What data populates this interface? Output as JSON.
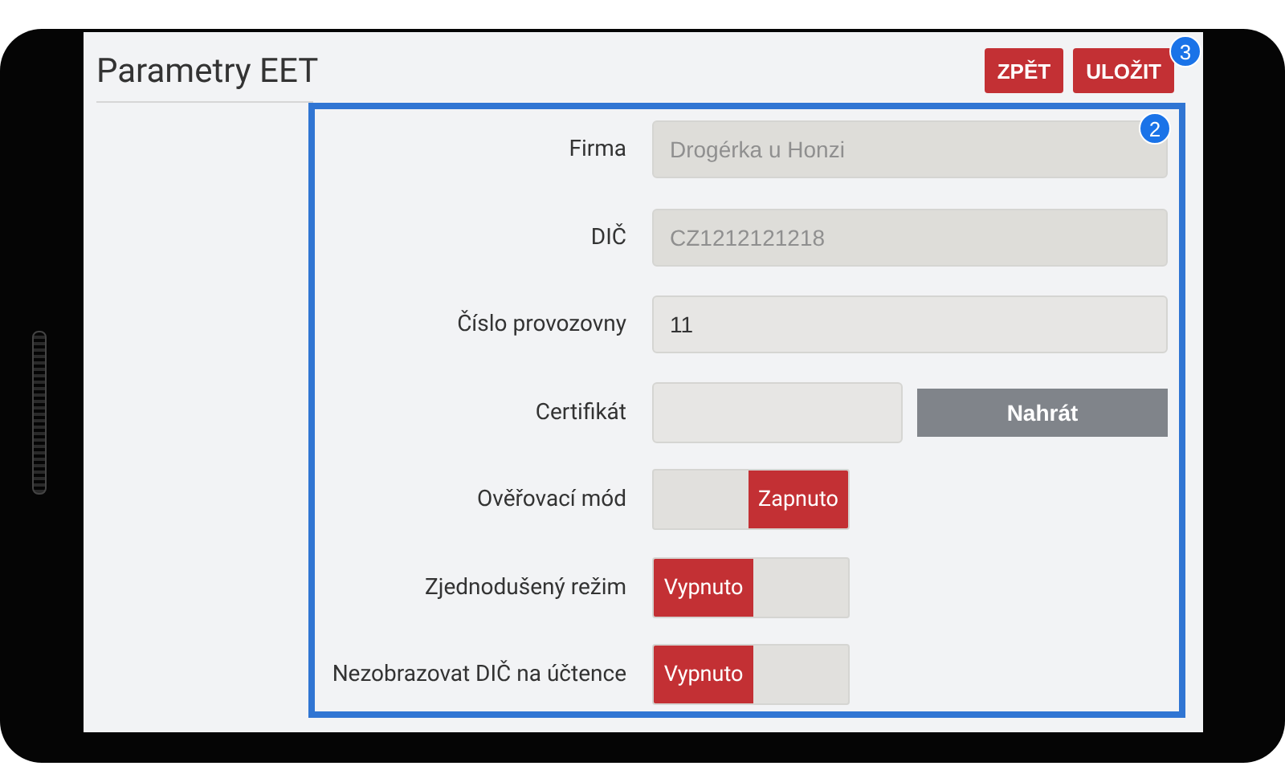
{
  "header": {
    "title": "Parametry EET"
  },
  "buttons": [
    {
      "label": "ZPĚT"
    },
    {
      "label": "ULOŽIT"
    }
  ],
  "badges": [
    {
      "label": "3"
    },
    {
      "label": "2"
    }
  ],
  "form": [
    {
      "kind": "text",
      "label": "Firma",
      "value": "Drogérka u Honzi",
      "disabled": true
    },
    {
      "kind": "text",
      "label": "DIČ",
      "value": "CZ1212121218",
      "disabled": true
    },
    {
      "kind": "text",
      "label": "Číslo provozovny",
      "value": "11",
      "disabled": false
    },
    {
      "kind": "file",
      "label": "Certifikát",
      "button": "Nahrát"
    },
    {
      "kind": "toggle",
      "label": "Ověřovací mód",
      "on": true,
      "state_label": "Zapnuto"
    },
    {
      "kind": "toggle",
      "label": "Zjednodušený režim",
      "on": false,
      "state_label": "Vypnuto"
    },
    {
      "kind": "toggle",
      "label": "Nezobrazovat DIČ na účtence",
      "on": false,
      "state_label": "Vypnuto"
    }
  ]
}
